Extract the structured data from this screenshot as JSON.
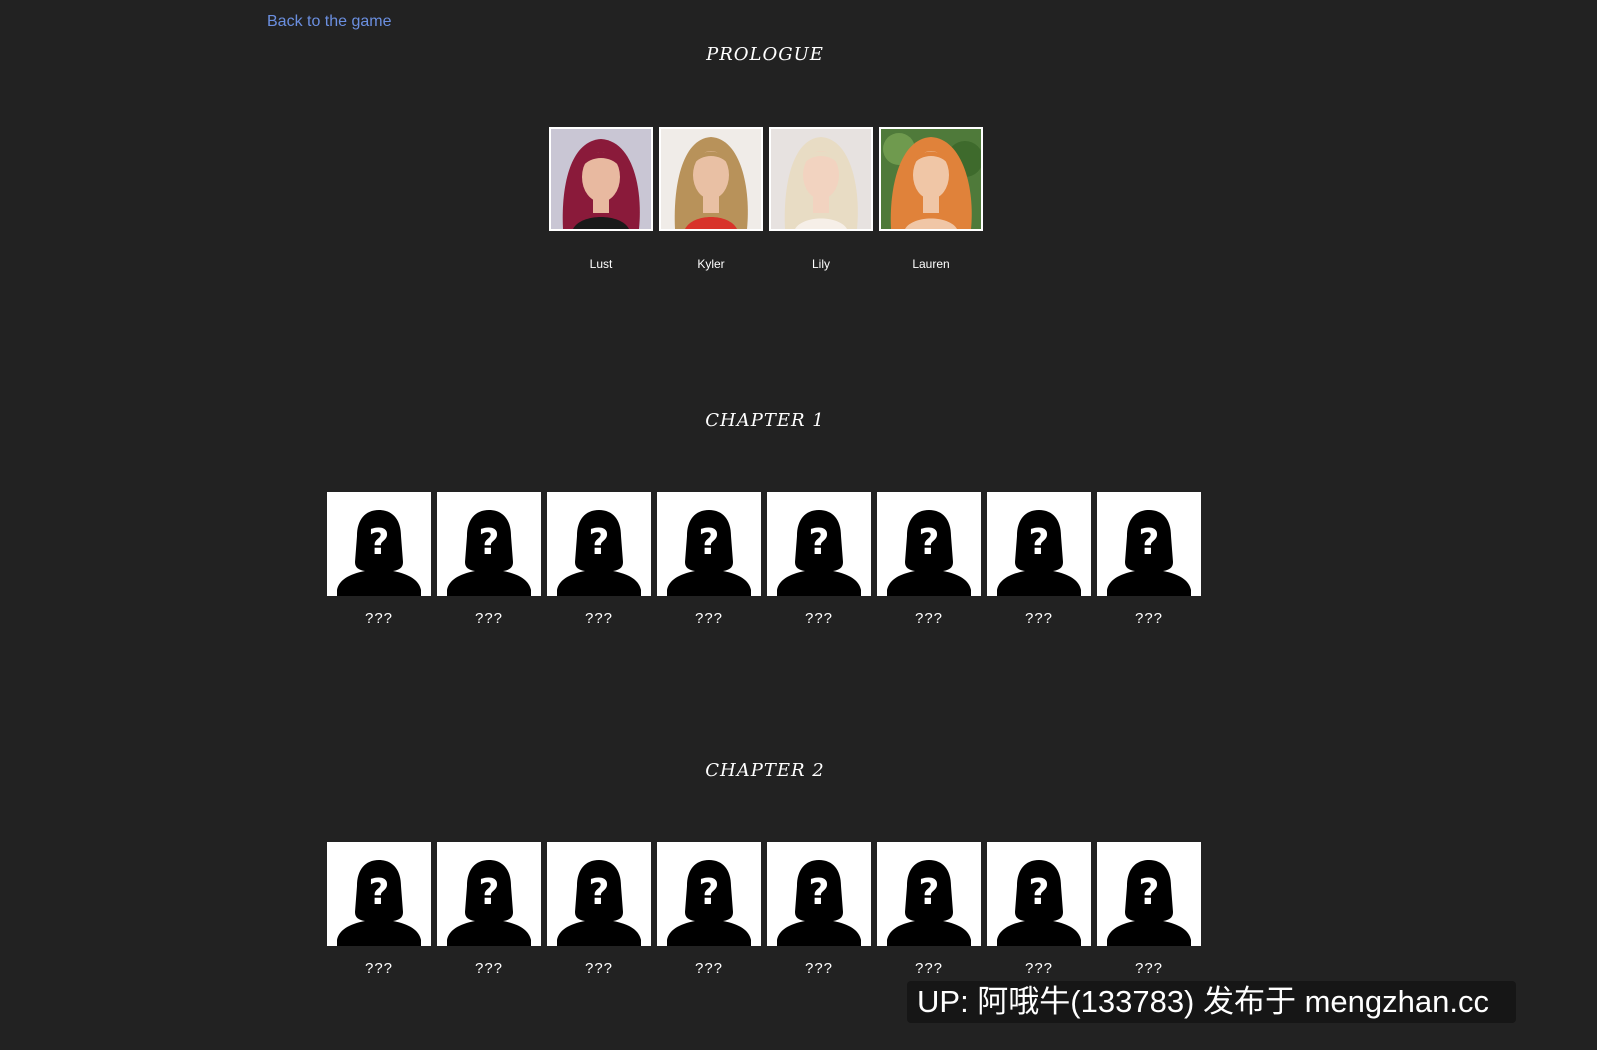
{
  "nav": {
    "back_label": "Back to the game"
  },
  "colors": {
    "background": "#222222",
    "link": "#6b8fe0",
    "text": "#ffffff"
  },
  "sections": [
    {
      "title": "PROLOGUE",
      "characters": [
        {
          "name": "Lust",
          "hair": "#8a1a3a",
          "skin": "#e8b9a0",
          "bg": "#c9c6d4"
        },
        {
          "name": "Kyler",
          "hair": "#b8925a",
          "skin": "#e9c0a4",
          "bg": "#f0ece8"
        },
        {
          "name": "Lily",
          "hair": "#e8dcc4",
          "skin": "#f2d3c0",
          "bg": "#e7e2e0"
        },
        {
          "name": "Lauren",
          "hair": "#e0823a",
          "skin": "#f0c6a6",
          "bg": "#4f7a3a"
        }
      ]
    },
    {
      "title": "CHAPTER 1",
      "locked": [
        "???",
        "???",
        "???",
        "???",
        "???",
        "???",
        "???",
        "???"
      ]
    },
    {
      "title": "CHAPTER 2",
      "locked": [
        "???",
        "???",
        "???",
        "???",
        "???",
        "???",
        "???",
        "???"
      ]
    }
  ],
  "watermark": "UP: 阿哦牛(133783) 发布于 mengzhan.cc"
}
